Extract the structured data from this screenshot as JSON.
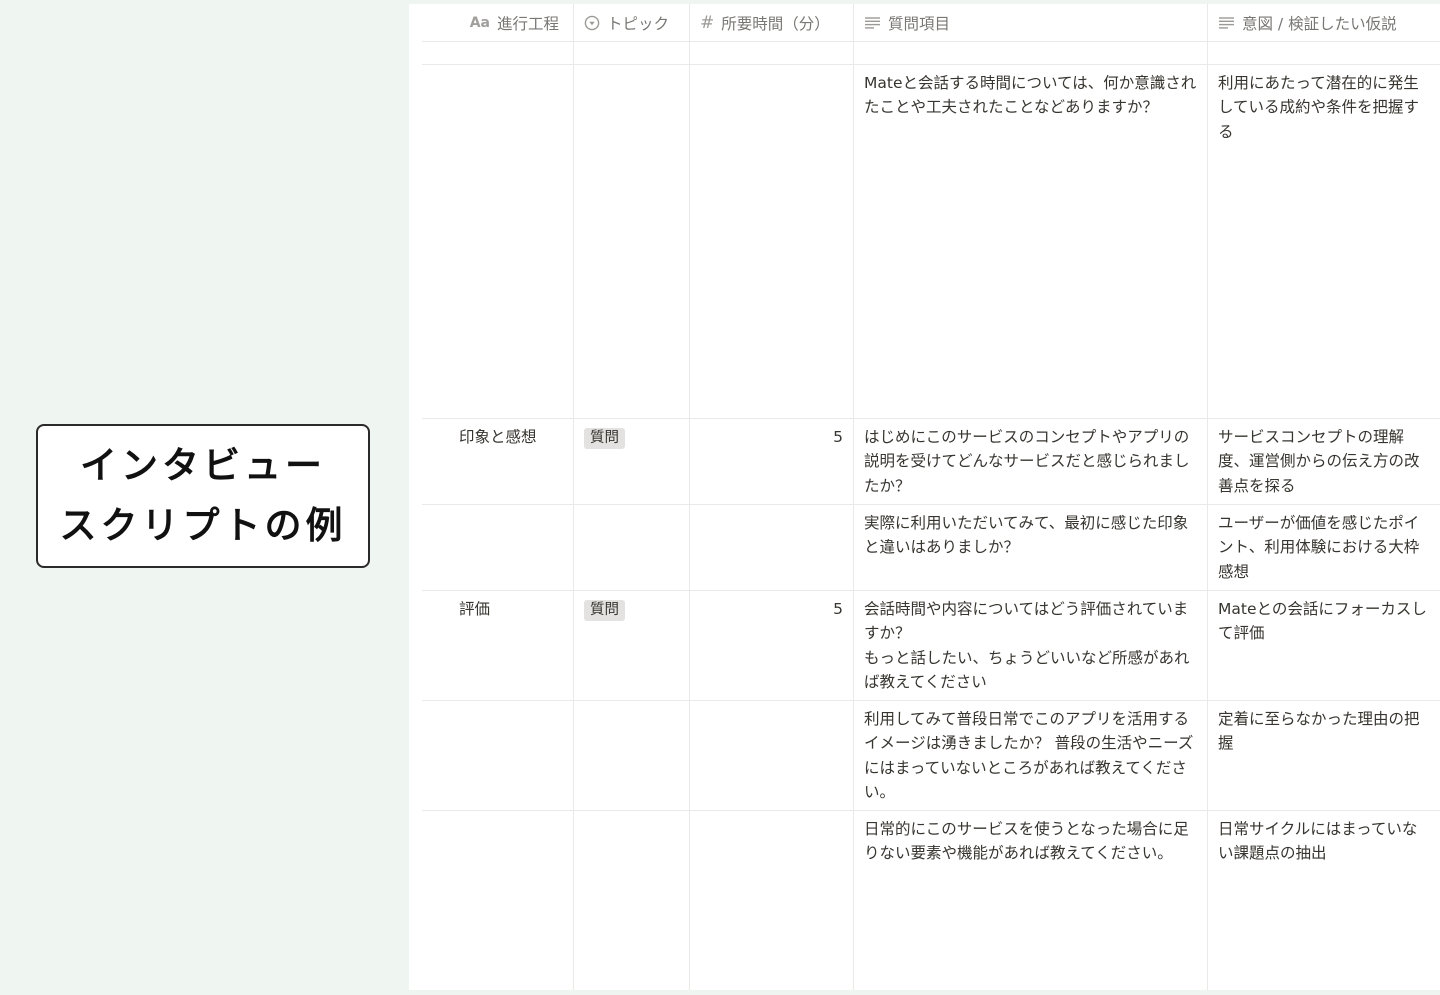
{
  "title_card": {
    "line1": "インタビュー",
    "line2": "スクリプトの例"
  },
  "columns": [
    {
      "icon": "text-type-icon",
      "icon_glyph": "Aa",
      "label": "進行工程"
    },
    {
      "icon": "select-icon",
      "label": "トピック"
    },
    {
      "icon": "number-icon",
      "icon_glyph": "#",
      "label": "所要時間（分）"
    },
    {
      "icon": "text-lines-icon",
      "label": "質問項目"
    },
    {
      "icon": "text-lines-icon",
      "label": "意図 / 検証したい仮説"
    }
  ],
  "rows": [
    {
      "process": "",
      "topic": "",
      "minutes": "",
      "question": "",
      "intent": ""
    },
    {
      "process": "",
      "topic": "",
      "minutes": "",
      "question": "Mateと会話する時間については、何か意識されたことや工夫されたことなどありますか？",
      "intent": "利用にあたって潜在的に発生している成約や条件を把握する"
    },
    {
      "process": "印象と感想",
      "topic": "質問",
      "minutes": "5",
      "question": "はじめにこのサービスのコンセプトやアプリの説明を受けてどんなサービスだと感じられましたか？",
      "intent": "サービスコンセプトの理解度、運営側からの伝え方の改善点を探る"
    },
    {
      "process": "",
      "topic": "",
      "minutes": "",
      "question": "実際に利用いただいてみて、最初に感じた印象と違いはありましか？",
      "intent": "ユーザーが価値を感じたポイント、利用体験における大枠感想"
    },
    {
      "process": "評価",
      "topic": "質問",
      "minutes": "5",
      "question": "会話時間や内容についてはどう評価されていますか？\nもっと話したい、ちょうどいいなど所感があれば教えてください",
      "intent": "Mateとの会話にフォーカスして評価"
    },
    {
      "process": "",
      "topic": "",
      "minutes": "",
      "question": "利用してみて普段日常でこのアプリを活用するイメージは湧きましたか？ 普段の生活やニーズにはまっていないところがあれば教えてください。",
      "intent": "定着に至らなかった理由の把握"
    },
    {
      "process": "",
      "topic": "",
      "minutes": "",
      "question": "日常的にこのサービスを使うとなった場合に足りない要素や機能があれば教えてください。",
      "intent": "日常サイクルにはまっていない課題点の抽出"
    }
  ]
}
